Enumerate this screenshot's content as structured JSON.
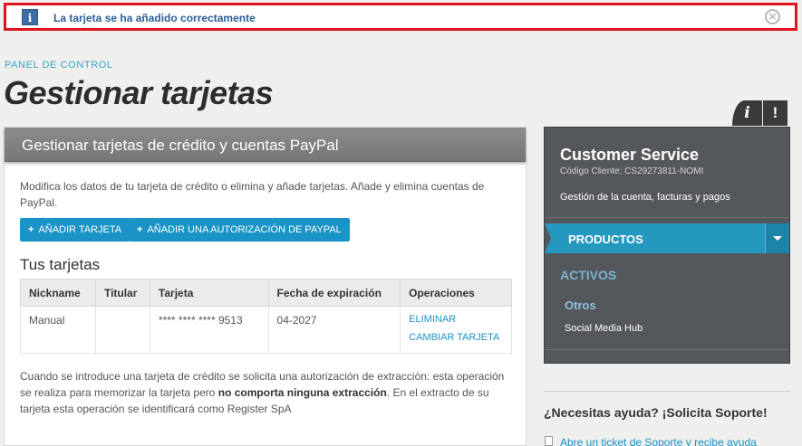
{
  "notification": {
    "icon": "info-icon",
    "message": "La tarjeta se ha añadido correctamente",
    "close_icon": "close-circle-icon"
  },
  "breadcrumb": "PANEL DE CONTROL",
  "page_title": "Gestionar tarjetas",
  "panel": {
    "title": "Gestionar tarjetas de crédito y cuentas PayPal",
    "intro": "Modifica los datos de tu tarjeta de crédito o elimina y añade tarjetas. Añade y elimina cuentas de PayPal.",
    "buttons": {
      "add_card": "AÑADIR TARJETA",
      "add_paypal": "AÑADIR UNA AUTORIZACIÓN DE PAYPAL"
    },
    "cards_title": "Tus tarjetas",
    "table": {
      "headers": [
        "Nickname",
        "Titular",
        "Tarjeta",
        "Fecha de expiración",
        "Operaciones"
      ],
      "rows": [
        {
          "nickname": "Manual",
          "holder": "",
          "card": "**** **** **** 9513",
          "expiry": "04-2027",
          "ops": [
            "ELIMINAR",
            "CAMBIAR TARJETA"
          ]
        }
      ]
    },
    "footnote": {
      "part1": "Cuando se introduce una tarjeta de crédito se solicita una autorización de extracción: esta operación se realiza para memorizar la tarjeta pero ",
      "bold": "no comporta ninguna extracción",
      "part2": ". En el extracto de su tarjeta esta operación se identificará como Register SpA"
    }
  },
  "tabs": {
    "info": "i",
    "alert": "!"
  },
  "sidebar": {
    "title": "Customer Service",
    "client_code": "Código Cliente: CS29273811-NOMI",
    "description": "Gestión de la cuenta, facturas y pagos",
    "products_label": "PRODUCTOS",
    "active_label": "ACTIVOS",
    "group": "Otros",
    "item": "Social Media Hub"
  },
  "help": {
    "title": "¿Necesitas ayuda? ¡Solicita Soporte!",
    "link": "Abre un ticket de Soporte y recibe ayuda"
  }
}
